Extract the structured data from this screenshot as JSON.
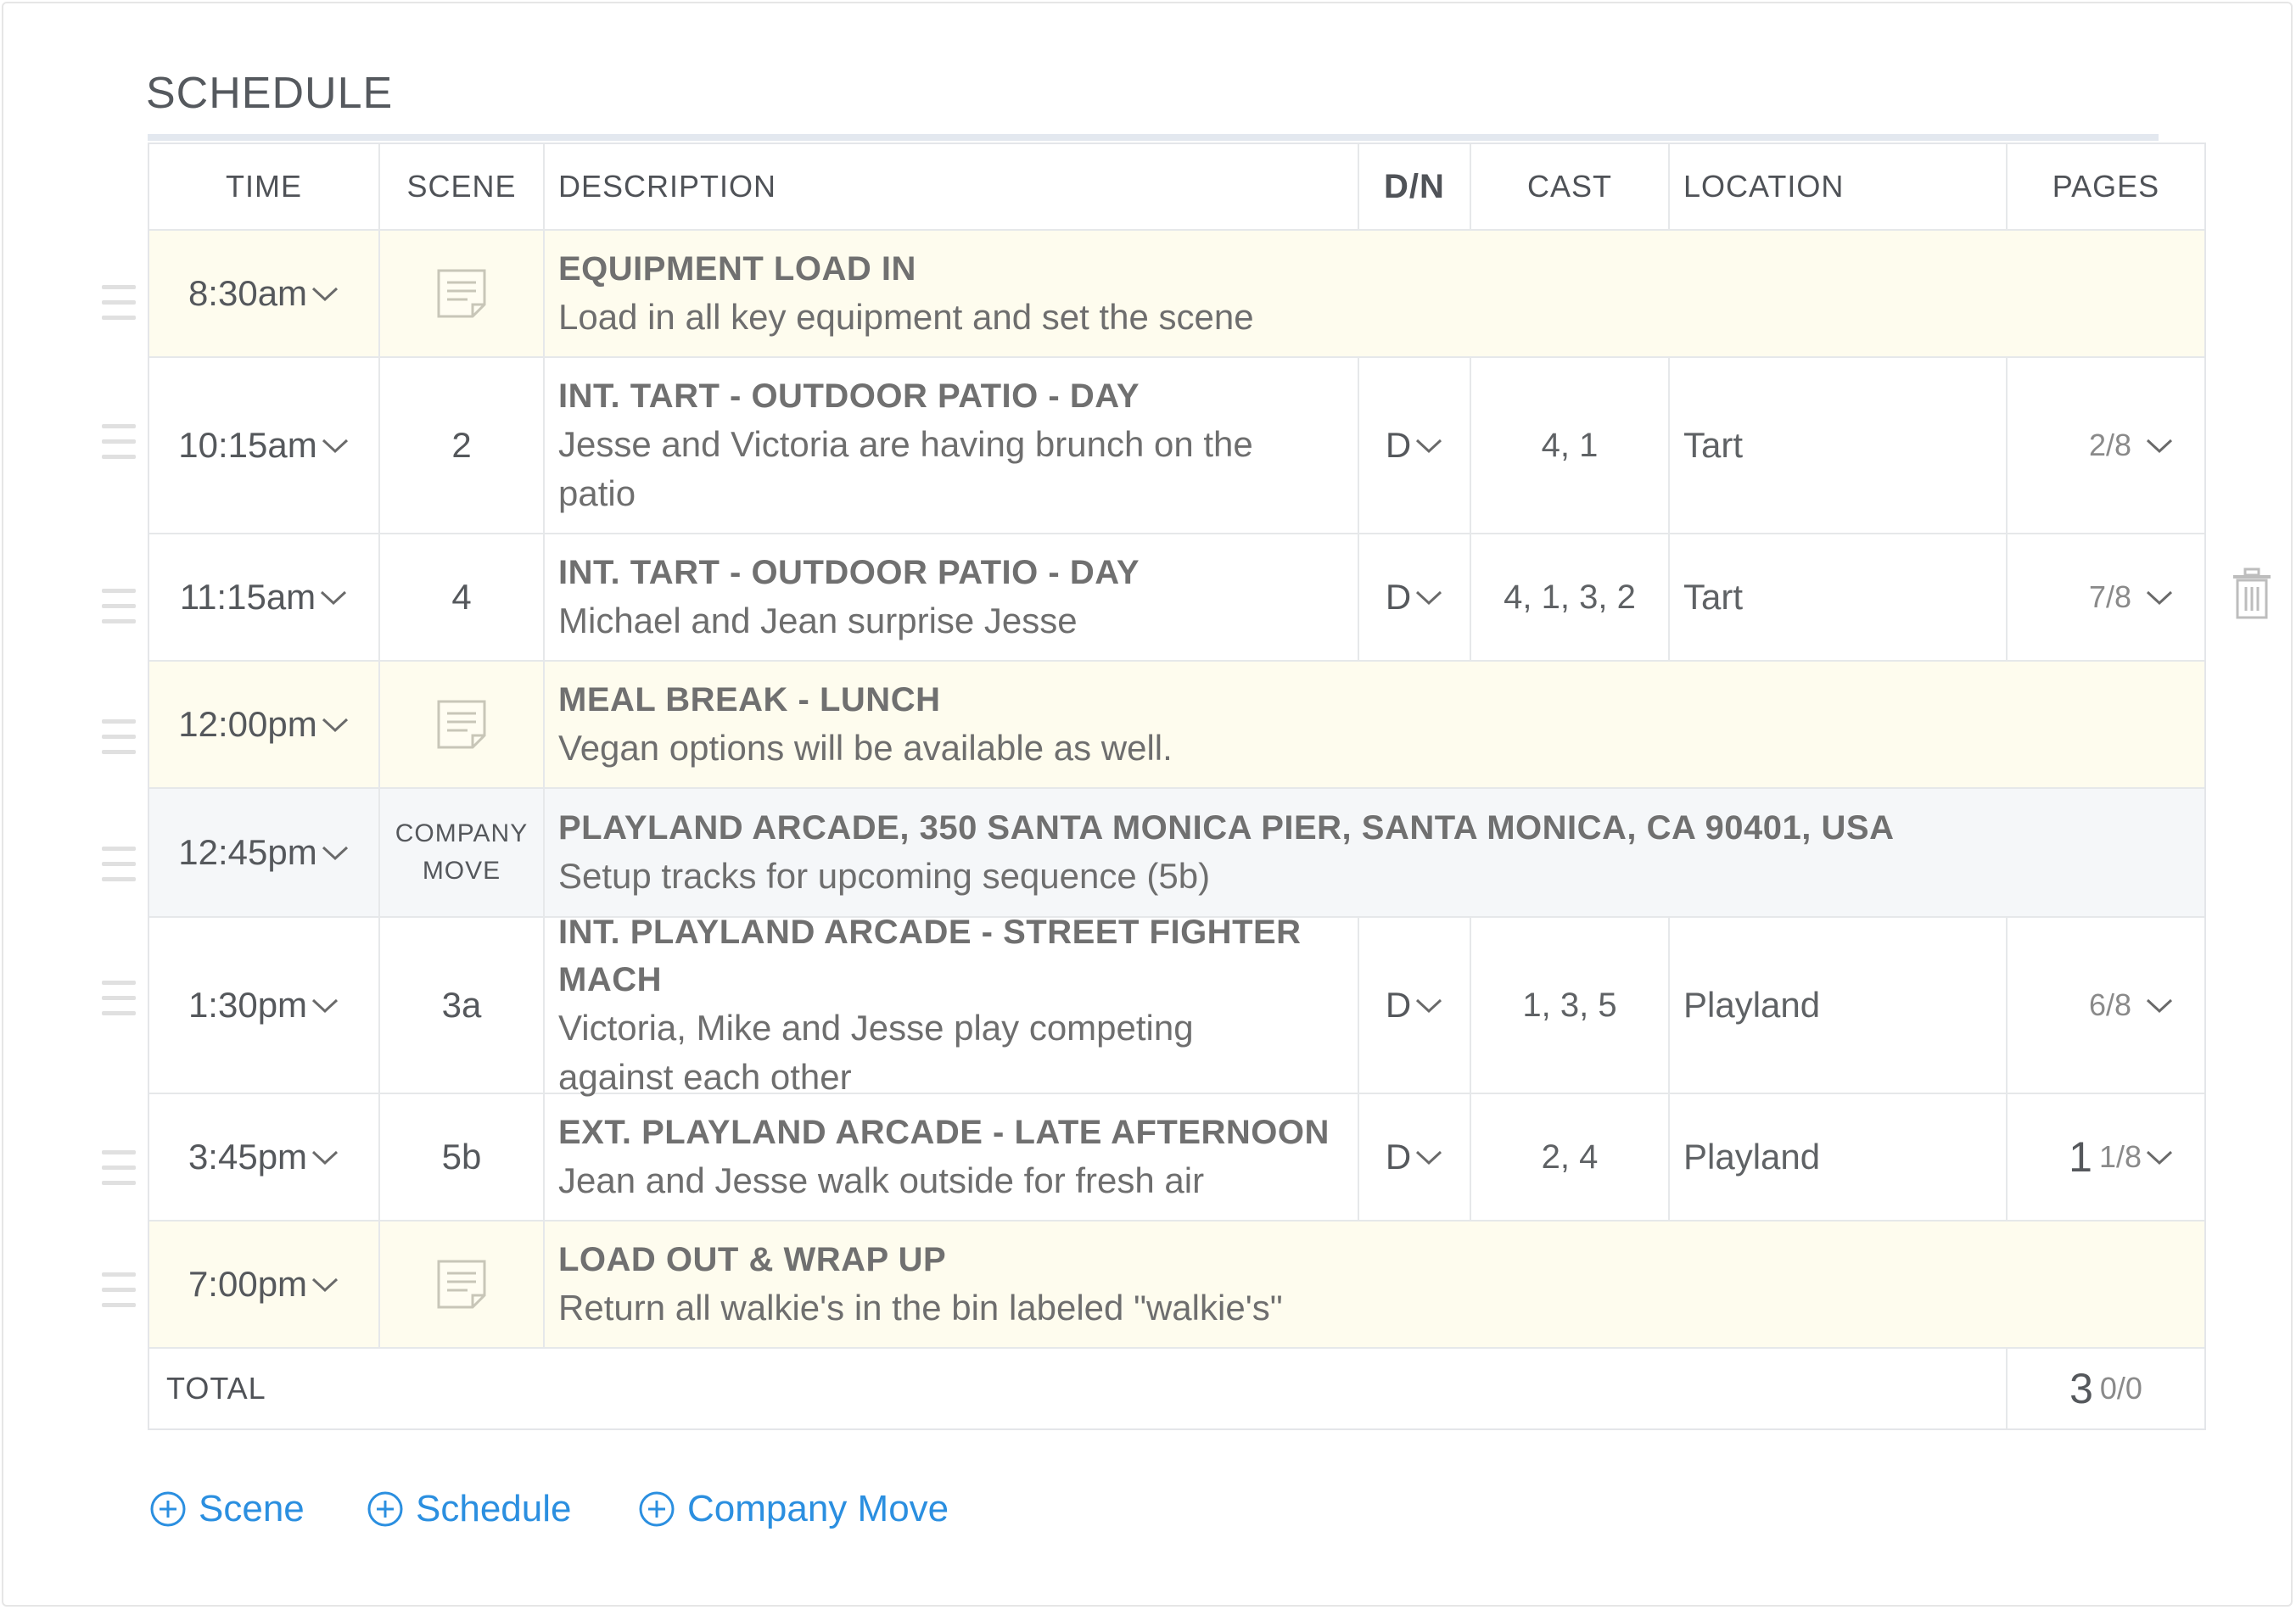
{
  "title": "SCHEDULE",
  "columns": {
    "time": "TIME",
    "scene": "SCENE",
    "description": "DESCRIPTION",
    "dn": "D/N",
    "cast": "CAST",
    "location": "LOCATION",
    "pages": "PAGES"
  },
  "rows": [
    {
      "time": "8:30am",
      "heading": "EQUIPMENT LOAD IN",
      "text": "Load in all key equipment and set the scene"
    },
    {
      "time": "10:15am",
      "scene": "2",
      "heading": "INT. TART - OUTDOOR PATIO - DAY",
      "text_1": "Jesse and Victoria are having brunch on the",
      "text_2": "patio",
      "dn": "D",
      "cast": "4, 1",
      "location": "Tart",
      "pages": "2/8"
    },
    {
      "time": "11:15am",
      "scene": "4",
      "heading": "INT. TART - OUTDOOR PATIO - DAY",
      "text": "Michael and Jean surprise Jesse",
      "dn": "D",
      "cast": "4, 1, 3, 2",
      "location": "Tart",
      "pages": "7/8"
    },
    {
      "time": "12:00pm",
      "heading": "MEAL BREAK - LUNCH",
      "text": "Vegan options will be available as well."
    },
    {
      "time": "12:45pm",
      "scene_1": "COMPANY",
      "scene_2": "MOVE",
      "heading": "PLAYLAND ARCADE, 350 SANTA MONICA PIER, SANTA MONICA, CA 90401, USA",
      "text": "Setup tracks for upcoming sequence (5b)"
    },
    {
      "time": "1:30pm",
      "scene": "3a",
      "heading": "INT. PLAYLAND ARCADE - STREET FIGHTER MACH",
      "text_1": "Victoria, Mike and Jesse play competing",
      "text_2": "against each other",
      "dn": "D",
      "cast": "1, 3, 5",
      "location": "Playland",
      "pages": "6/8"
    },
    {
      "time": "3:45pm",
      "scene": "5b",
      "heading": "EXT. PLAYLAND ARCADE - LATE AFTERNOON",
      "text": "Jean and Jesse walk outside for fresh air",
      "dn": "D",
      "cast": "2, 4",
      "location": "Playland",
      "pages_whole": "1",
      "pages": "1/8"
    },
    {
      "time": "7:00pm",
      "heading": "LOAD OUT & WRAP UP",
      "text": "Return all walkie's in the bin labeled \"walkie's\""
    }
  ],
  "total": {
    "label": "TOTAL",
    "whole": "3",
    "fraction": "0/0"
  },
  "actions": {
    "scene": "Scene",
    "schedule": "Schedule",
    "company_move": "Company Move"
  },
  "icons": {
    "row_handle": "drag-handle-icon",
    "note": "note-icon",
    "chevron": "chevron-down-icon",
    "delete": "trash-icon",
    "add": "plus-circle-icon"
  },
  "colors": {
    "note_row": "#fefcee",
    "move_row": "#f5f7f9",
    "link": "#2b8fe0"
  }
}
